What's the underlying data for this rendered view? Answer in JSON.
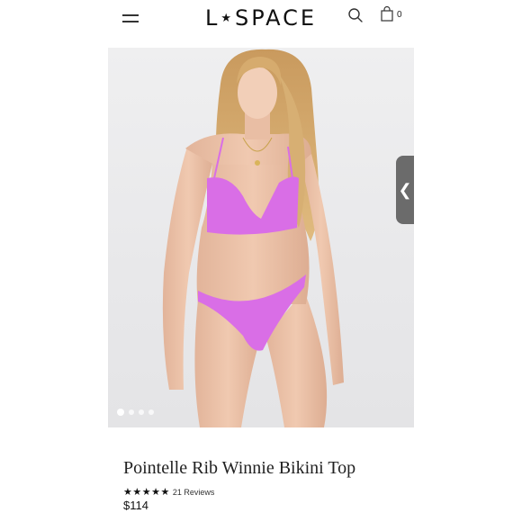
{
  "header": {
    "logo_left": "L",
    "logo_star": "★",
    "logo_right": "SPACE",
    "cart_count": "0"
  },
  "icons": {
    "menu": "menu-icon",
    "search": "search-icon",
    "cart": "bag-icon",
    "carousel_prev": "chevron-left-icon"
  },
  "carousel": {
    "slides_total": 4,
    "active_slide": 1,
    "side_tab_glyph": "❮"
  },
  "product": {
    "title": "Pointelle Rib Winnie Bikini Top",
    "stars": "★★★★★",
    "reviews": "21 Reviews",
    "price": "$114",
    "rating_value": 5
  },
  "colors": {
    "swimsuit": "#d96ee6",
    "background": "#ffffff",
    "text": "#111111"
  }
}
